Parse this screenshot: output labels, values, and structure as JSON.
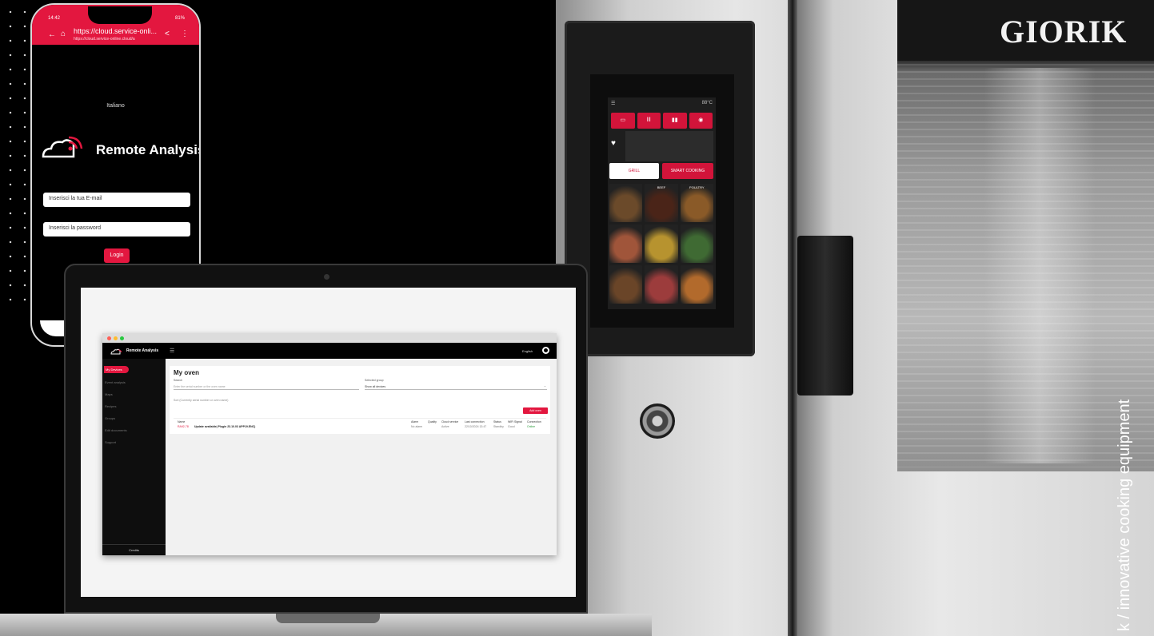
{
  "oven": {
    "brand": "GIORIK",
    "tagline": "k / innovative cooking equipment",
    "screen": {
      "status": "88°C",
      "tabs": [
        "",
        "lll",
        "",
        ""
      ],
      "grill": "GRILL",
      "smart": "SMART COOKING",
      "foods": [
        {
          "label": "",
          "color": "#6b4a2a"
        },
        {
          "label": "BEEF",
          "color": "#4a2418"
        },
        {
          "label": "POULTRY",
          "color": "#8a5a28"
        },
        {
          "label": "",
          "color": "#a0553a"
        },
        {
          "label": "",
          "color": "#b7932f"
        },
        {
          "label": "",
          "color": "#3f6a33"
        },
        {
          "label": "",
          "color": "#6a4528"
        },
        {
          "label": "",
          "color": "#9c3c3c"
        },
        {
          "label": "",
          "color": "#b26a2c"
        }
      ]
    }
  },
  "phone": {
    "time": "14:42",
    "battery": "81%",
    "url": "https://cloud.service-onli...",
    "url_sub": "https://cloud.service-online.cloud/a",
    "language": "Italiano",
    "app_title": "Remote Analysis",
    "email_placeholder": "Inserisci la tua E-mail",
    "password_placeholder": "Inserisci la password",
    "login_label": "Login"
  },
  "desktop": {
    "brand": "Remote Analysis",
    "language": "English",
    "sidebar": {
      "active": "My Devices",
      "items": [
        "Event analysis",
        "Maps",
        "Recipes",
        "Groups",
        "Edit documents",
        "Support"
      ],
      "footer": "Credits"
    },
    "card": {
      "title": "My oven",
      "search_label": "Search",
      "search_placeholder": "Enter the serial number or the oven name",
      "group_label": "Selected group",
      "group_value": "Show all devices",
      "note": "Sort (Currently serial number or oven name)",
      "add_button": "Add oven",
      "columns": [
        "Name",
        "Alarm",
        "Quality",
        "Cloud service",
        "Last connection",
        "Status",
        "WiFi Signal",
        "Connection"
      ],
      "row": {
        "serial": "RA92-78",
        "name": "Update available| Plugin 23.10.03 APP19.ENC)",
        "alarm": "No alarm",
        "quality": "",
        "cloud": "Active",
        "last": "22/10/2024 13:47",
        "status": "Standby",
        "wifi": "Good",
        "connection": "Online"
      }
    }
  },
  "colors": {
    "accent": "#e3173f",
    "background": "#000000"
  }
}
